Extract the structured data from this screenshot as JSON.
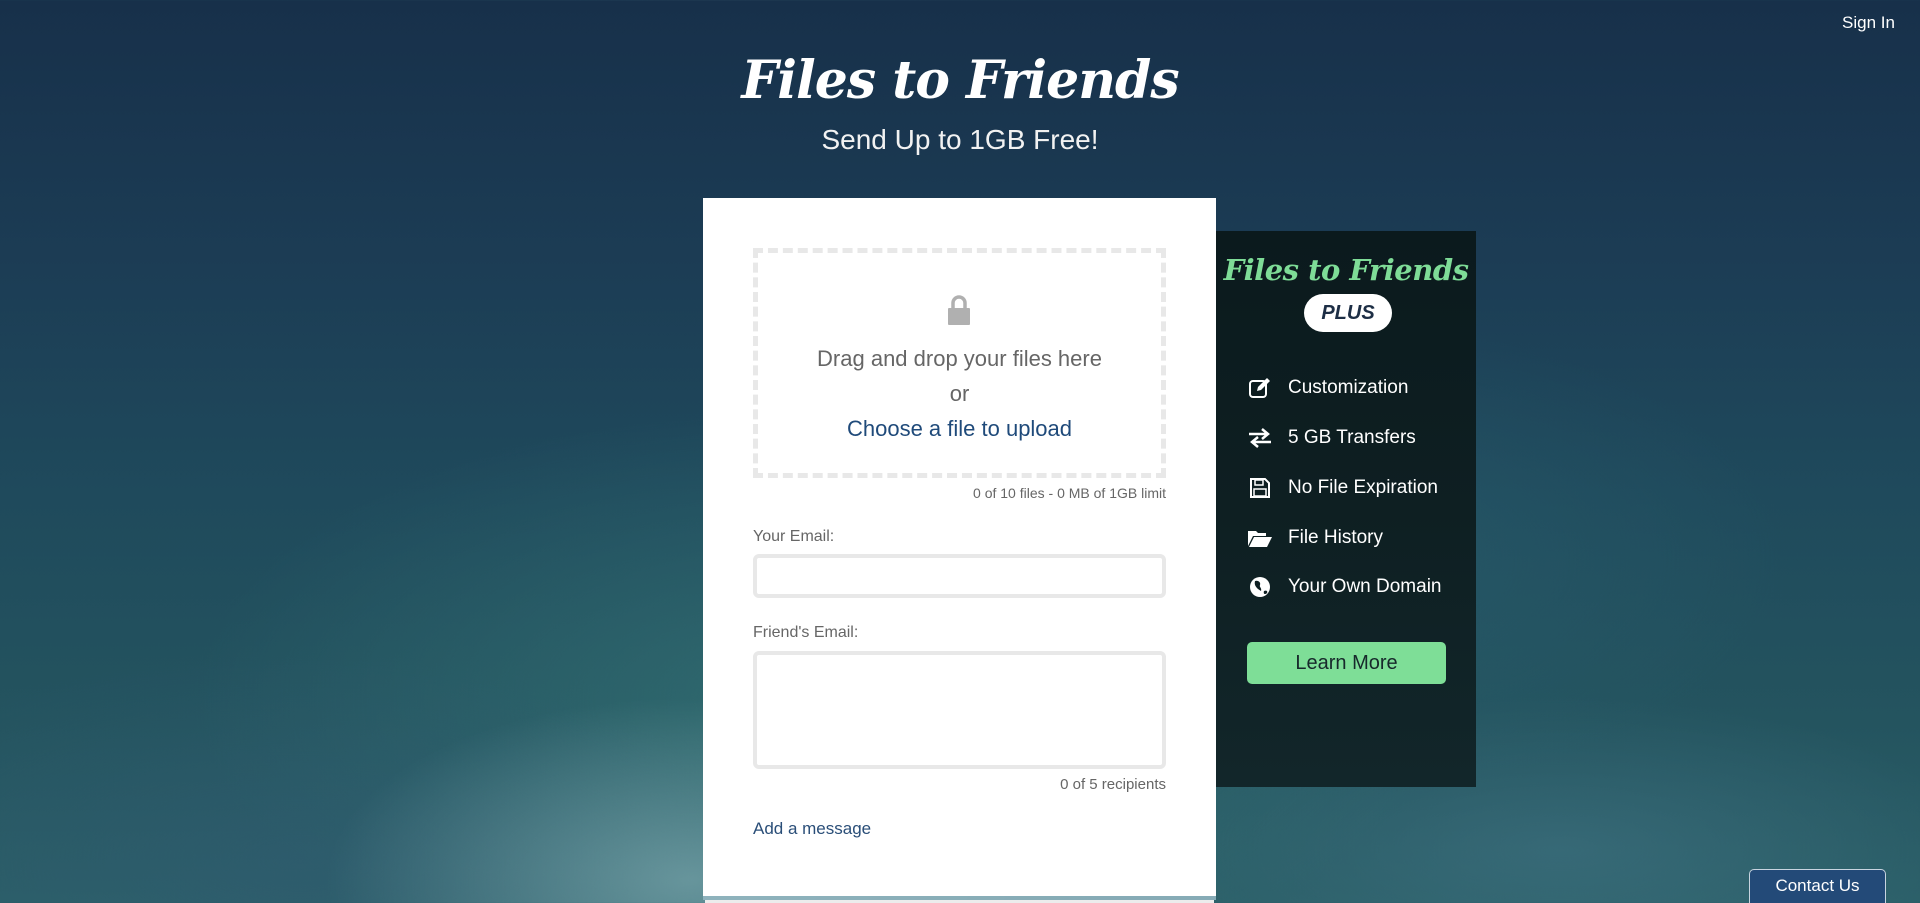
{
  "header": {
    "sign_in": "Sign In",
    "brand_title": "Files to Friends",
    "tagline": "Send Up to 1GB Free!"
  },
  "upload": {
    "lock_icon": "lock-icon",
    "drop_text": "Drag and drop your files here",
    "or_text": "or",
    "choose_file": "Choose a file to upload",
    "file_limit": "0 of 10 files - 0 MB of 1GB limit"
  },
  "form": {
    "your_email_label": "Your Email:",
    "your_email_value": "",
    "friend_email_label": "Friend's Email:",
    "friend_email_value": "",
    "recipient_count": "0 of 5 recipients",
    "add_message": "Add a message"
  },
  "plus": {
    "title": "Files to Friends",
    "badge": "PLUS",
    "features": [
      {
        "icon": "edit-icon",
        "label": "Customization"
      },
      {
        "icon": "transfer-arrows-icon",
        "label": "5 GB Transfers"
      },
      {
        "icon": "floppy-disk-icon",
        "label": "No File Expiration"
      },
      {
        "icon": "folder-open-icon",
        "label": "File History"
      },
      {
        "icon": "globe-icon",
        "label": "Your Own Domain"
      }
    ],
    "learn_more": "Learn More"
  },
  "footer": {
    "contact_us": "Contact Us"
  },
  "colors": {
    "accent_green": "#7ede97",
    "link_blue": "#1f4a7a",
    "contact_button": "#234a78",
    "plus_panel": "#0e1f22"
  }
}
